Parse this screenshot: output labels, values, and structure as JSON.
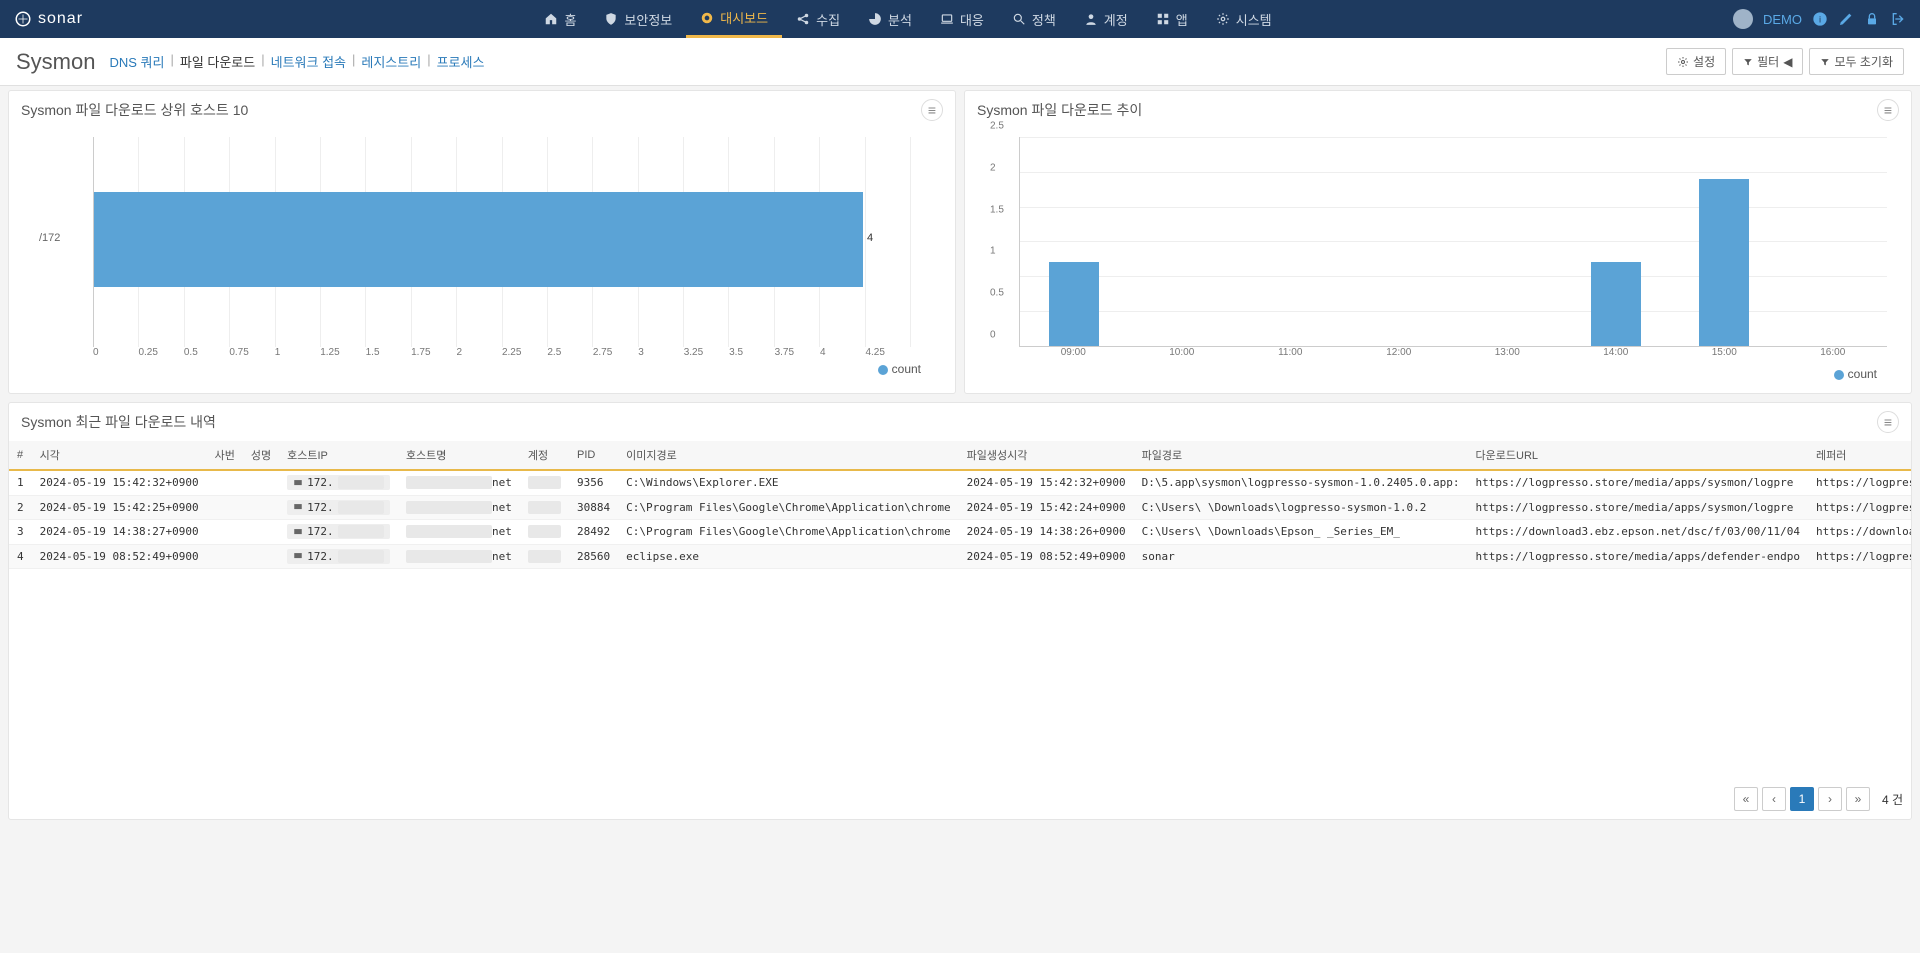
{
  "logo_text": "sonar",
  "nav": [
    {
      "icon": "home",
      "label": "홈"
    },
    {
      "icon": "shield",
      "label": "보안정보"
    },
    {
      "icon": "dashboard",
      "label": "대시보드",
      "active": true
    },
    {
      "icon": "share",
      "label": "수집"
    },
    {
      "icon": "chart",
      "label": "분석"
    },
    {
      "icon": "laptop",
      "label": "대응"
    },
    {
      "icon": "search",
      "label": "정책"
    },
    {
      "icon": "user",
      "label": "계정"
    },
    {
      "icon": "grid",
      "label": "앱"
    },
    {
      "icon": "gear",
      "label": "시스템"
    }
  ],
  "user": "DEMO",
  "page_title": "Sysmon",
  "subtabs": [
    "DNS 쿼리",
    "파일 다운로드",
    "네트워크 접속",
    "레지스트리",
    "프로세스"
  ],
  "subtab_active": 1,
  "btn_settings": "설정",
  "btn_filter": "필터",
  "btn_reset": "모두 초기화",
  "panel1_title": "Sysmon 파일 다운로드 상위 호스트 10",
  "panel2_title": "Sysmon 파일 다운로드 추이",
  "legend_label": "count",
  "chart_data": [
    {
      "type": "bar",
      "orientation": "horizontal",
      "title": "Sysmon 파일 다운로드 상위 호스트 10",
      "categories": [
        "/172"
      ],
      "values": [
        4
      ],
      "xlim": [
        0,
        4.25
      ],
      "xticks": [
        0,
        0.25,
        0.5,
        0.75,
        1,
        1.25,
        1.5,
        1.75,
        2,
        2.25,
        2.5,
        2.75,
        3,
        3.25,
        3.5,
        3.75,
        4,
        4.25
      ],
      "legend": "count"
    },
    {
      "type": "bar",
      "orientation": "vertical",
      "title": "Sysmon 파일 다운로드 추이",
      "x": [
        "09:00",
        "10:00",
        "11:00",
        "12:00",
        "13:00",
        "14:00",
        "15:00",
        "16:00"
      ],
      "values": [
        1,
        0,
        0,
        0,
        0,
        1,
        2,
        0
      ],
      "ylim": [
        0,
        2.5
      ],
      "yticks": [
        0,
        0.5,
        1,
        1.5,
        2,
        2.5
      ],
      "legend": "count"
    }
  ],
  "table_title": "Sysmon 최근 파일 다운로드 내역",
  "columns": [
    "#",
    "시각",
    "사번",
    "성명",
    "호스트IP",
    "호스트명",
    "계정",
    "PID",
    "이미지경로",
    "파일생성시각",
    "파일경로",
    "다운로드URL",
    "레퍼러"
  ],
  "rows": [
    {
      "n": 1,
      "time": "2024-05-19 15:42:32+0900",
      "emp": "",
      "name": "",
      "hostip": "172.",
      "hostname": "net",
      "acct": "",
      "pid": "9356",
      "imgpath": "C:\\Windows\\Explorer.EXE",
      "ctime": "2024-05-19 15:42:32+0900",
      "filepath": "D:\\5.app\\sysmon\\logpresso-sysmon-1.0.2405.0.app:",
      "durl": "https://logpresso.store/media/apps/sysmon/logpre",
      "ref": "https://logpresso.store"
    },
    {
      "n": 2,
      "time": "2024-05-19 15:42:25+0900",
      "emp": "",
      "name": "",
      "hostip": "172.",
      "hostname": "net",
      "acct": "",
      "pid": "30884",
      "imgpath": "C:\\Program Files\\Google\\Chrome\\Application\\chrome",
      "ctime": "2024-05-19 15:42:24+0900",
      "filepath": "C:\\Users\\     \\Downloads\\logpresso-sysmon-1.0.2",
      "durl": "https://logpresso.store/media/apps/sysmon/logpre",
      "ref": "https://logpresso.store"
    },
    {
      "n": 3,
      "time": "2024-05-19 14:38:27+0900",
      "emp": "",
      "name": "",
      "hostip": "172.",
      "hostname": "net",
      "acct": "",
      "pid": "28492",
      "imgpath": "C:\\Program Files\\Google\\Chrome\\Application\\chrome",
      "ctime": "2024-05-19 14:38:26+0900",
      "filepath": "C:\\Users\\     \\Downloads\\Epson_     _Series_EM_",
      "durl": "https://download3.ebz.epson.net/dsc/f/03/00/11/04",
      "ref": "https://download.ebz.eps"
    },
    {
      "n": 4,
      "time": "2024-05-19 08:52:49+0900",
      "emp": "",
      "name": "",
      "hostip": "172.",
      "hostname": "net",
      "acct": "",
      "pid": "28560",
      "imgpath": "          eclipse.exe",
      "ctime": "2024-05-19 08:52:49+0900",
      "filepath": "                                            sonar",
      "durl": "https://logpresso.store/media/apps/defender-endpo",
      "ref": "https://logpresso.store"
    }
  ],
  "pager_total": "4 건",
  "pager_current": "1"
}
